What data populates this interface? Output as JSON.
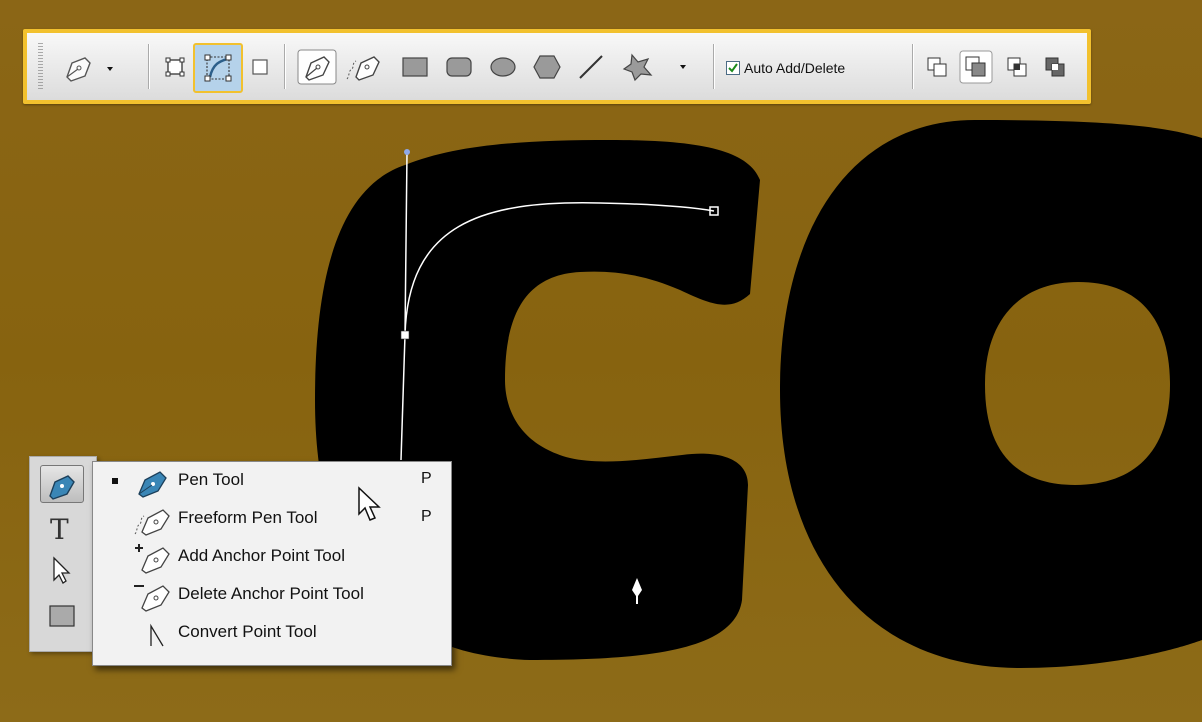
{
  "options_bar": {
    "tool_preset_icon": "pen-icon",
    "modes": [
      "shape-layers-icon",
      "paths-icon",
      "fill-pixels-icon"
    ],
    "selected_mode": "paths",
    "path_tools": [
      "pen-icon",
      "freeform-pen-icon",
      "rectangle-icon",
      "rounded-rectangle-icon",
      "ellipse-icon",
      "polygon-icon",
      "line-icon",
      "custom-shape-icon"
    ],
    "auto_add_delete_label": "Auto Add/Delete",
    "auto_add_delete_checked": true,
    "path_operations": [
      "combine-icon",
      "subtract-icon",
      "intersect-icon",
      "exclude-icon"
    ]
  },
  "canvas": {
    "background_color": "#8a6416",
    "text_color": "#000000",
    "accent_color": "#f2c12e"
  },
  "toolbox": {
    "tools": [
      "pen-icon",
      "type-icon",
      "path-selection-icon",
      "rectangle-icon"
    ]
  },
  "flyout": {
    "items": [
      {
        "label": "Pen Tool",
        "shortcut": "P",
        "icon": "pen-icon",
        "selected": true
      },
      {
        "label": "Freeform Pen Tool",
        "shortcut": "P",
        "icon": "freeform-pen-icon",
        "selected": false
      },
      {
        "label": "Add Anchor Point Tool",
        "shortcut": "",
        "icon": "add-anchor-icon",
        "selected": false
      },
      {
        "label": "Delete Anchor Point Tool",
        "shortcut": "",
        "icon": "delete-anchor-icon",
        "selected": false
      },
      {
        "label": "Convert Point Tool",
        "shortcut": "",
        "icon": "convert-point-icon",
        "selected": false
      }
    ]
  }
}
